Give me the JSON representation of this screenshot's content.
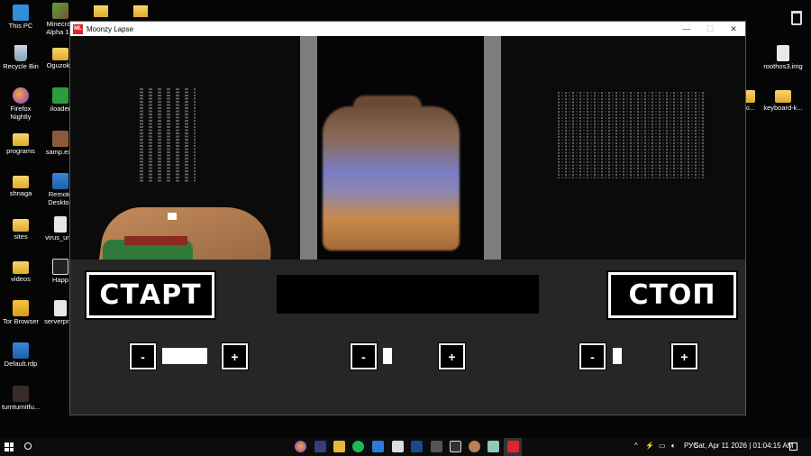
{
  "desktop": {
    "icons": [
      {
        "label": "This PC"
      },
      {
        "label": "Minecraft Alpha 1.1"
      },
      {
        "label": "Recycle Bin"
      },
      {
        "label": "OguzokE"
      },
      {
        "label": "Firefox Nightly"
      },
      {
        "label": "iloader"
      },
      {
        "label": "programs"
      },
      {
        "label": "samp.exe"
      },
      {
        "label": "shnaga"
      },
      {
        "label": "Remote Desktop"
      },
      {
        "label": "sites"
      },
      {
        "label": "virus_unlc"
      },
      {
        "label": "videos"
      },
      {
        "label": "Happ"
      },
      {
        "label": "Tor Browser"
      },
      {
        "label": "serverprop"
      },
      {
        "label": "Default.rdp"
      },
      {
        "label": "turnturnitfu..."
      },
      {
        "label": "roothos3.img"
      },
      {
        "label": "keyboard-k..."
      },
      {
        "label": "otki..."
      }
    ]
  },
  "window": {
    "title": "Moonzy Lapse",
    "logo_text": "ML",
    "minimize_glyph": "—",
    "maximize_glyph": "☐",
    "close_glyph": "✕"
  },
  "controls": {
    "start_label": "СТАРТ",
    "stop_label": "СТОП",
    "minus": "-",
    "plus": "+",
    "slider_levels": [
      1.0,
      0.2,
      0.2
    ]
  },
  "taskbar": {
    "language": "РУС",
    "datetime": "Sat, Apr 11 2026 | 01:04:15 AM"
  },
  "colors": {
    "window_bg": "#262626",
    "viewport_bg": "#0b0b0b",
    "pillar": "#7d7d7d",
    "logo_red": "#d9262f"
  }
}
